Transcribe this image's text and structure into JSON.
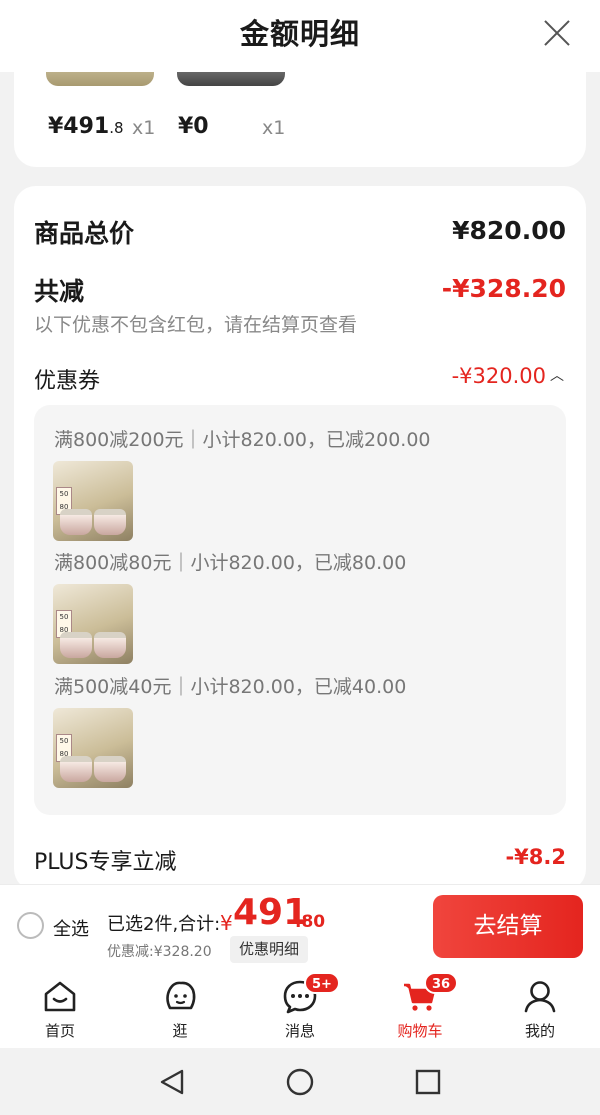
{
  "header": {
    "title": "金额明细"
  },
  "products": [
    {
      "price_int": "¥491",
      "price_dec": ".8",
      "qty": "x1"
    },
    {
      "price_int": "¥0",
      "price_dec": "",
      "qty": "x1"
    }
  ],
  "summary": {
    "total_label": "商品总价",
    "total_value": "¥820.00",
    "reduce_label": "共减",
    "reduce_value": "-¥328.20",
    "note": "以下优惠不包含红包，请在结算页查看",
    "coupon_label": "优惠券",
    "coupon_value": "-¥320.00",
    "coupons": [
      {
        "text": "满800减200元｜小计820.00，已减200.00"
      },
      {
        "text": "满800减80元｜小计820.00，已减80.00"
      },
      {
        "text": "满500减40元｜小计820.00，已减40.00"
      }
    ],
    "plus_label": "PLUS专享立减",
    "plus_value": "-¥8.2"
  },
  "checkout": {
    "select_all": "全选",
    "selected_text": "已选2件,合计:",
    "currency": "¥",
    "total_int": "491",
    "total_dec": ".80",
    "discount_text": "优惠减:¥328.20",
    "detail_button": "优惠明细",
    "pay_button": "去结算"
  },
  "tabs": [
    {
      "label": "首页",
      "icon": "home-icon"
    },
    {
      "label": "逛",
      "icon": "face-icon"
    },
    {
      "label": "消息",
      "icon": "message-icon",
      "badge": "5+"
    },
    {
      "label": "购物车",
      "icon": "cart-icon",
      "badge": "36",
      "active": true
    },
    {
      "label": "我的",
      "icon": "user-icon"
    }
  ],
  "colors": {
    "accent": "#e4251f",
    "background": "#f2f2f2"
  }
}
